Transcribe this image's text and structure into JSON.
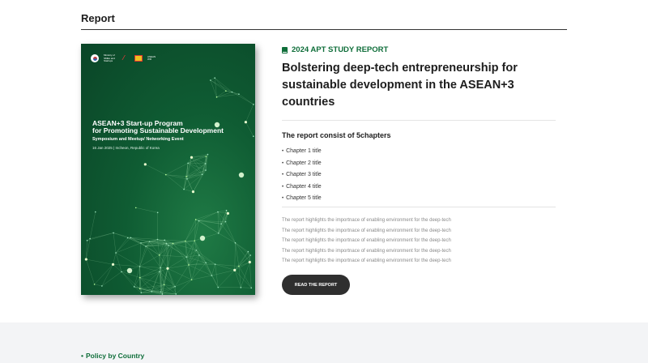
{
  "section": {
    "title": "Report"
  },
  "cover": {
    "logo_ministry": "Ministry of SMEs and Startups",
    "logo_wr": "ASEAN WR",
    "title_line1": "ASEAN+3 Start-up Program",
    "title_line2": "for Promoting Sustainable Development",
    "subtitle": "Symposium and Meetup/ Networking Event",
    "date": "16 Jan 2025  |  Incheon, Republic of Korea"
  },
  "report": {
    "tag": "2024 APT STUDY REPORT",
    "tag_icon": "book-icon",
    "headline": "Bolstering deep-tech entrepreneurship for sustainable development in the ASEAN+3 countries",
    "chapters_title": "The report consist of 5chapters",
    "chapters": [
      "Chapter 1 title",
      "Chapter 2 title",
      "Chapter 3 title",
      "Chapter 4 title",
      "Chapter 5 title"
    ],
    "description": [
      "The report highlights the importnace of enabling environment for the deep-tech",
      "The report highlights the importnace of enabling environment for the deep-tech",
      "The report highlights the importnace of enabling environment for the deep-tech",
      "The report highlights the importnace of enabling environment for the deep-tech",
      "The report highlights the importnace of enabling environment for the deep-tech"
    ],
    "button_label": "READ THE REPORT"
  },
  "footer": {
    "link_label": "Policy by Country"
  },
  "colors": {
    "accent": "#0f6e3a",
    "button": "#2f2f2f",
    "cover_bg": "#0f5c33",
    "footer_bg": "#f3f4f6"
  }
}
